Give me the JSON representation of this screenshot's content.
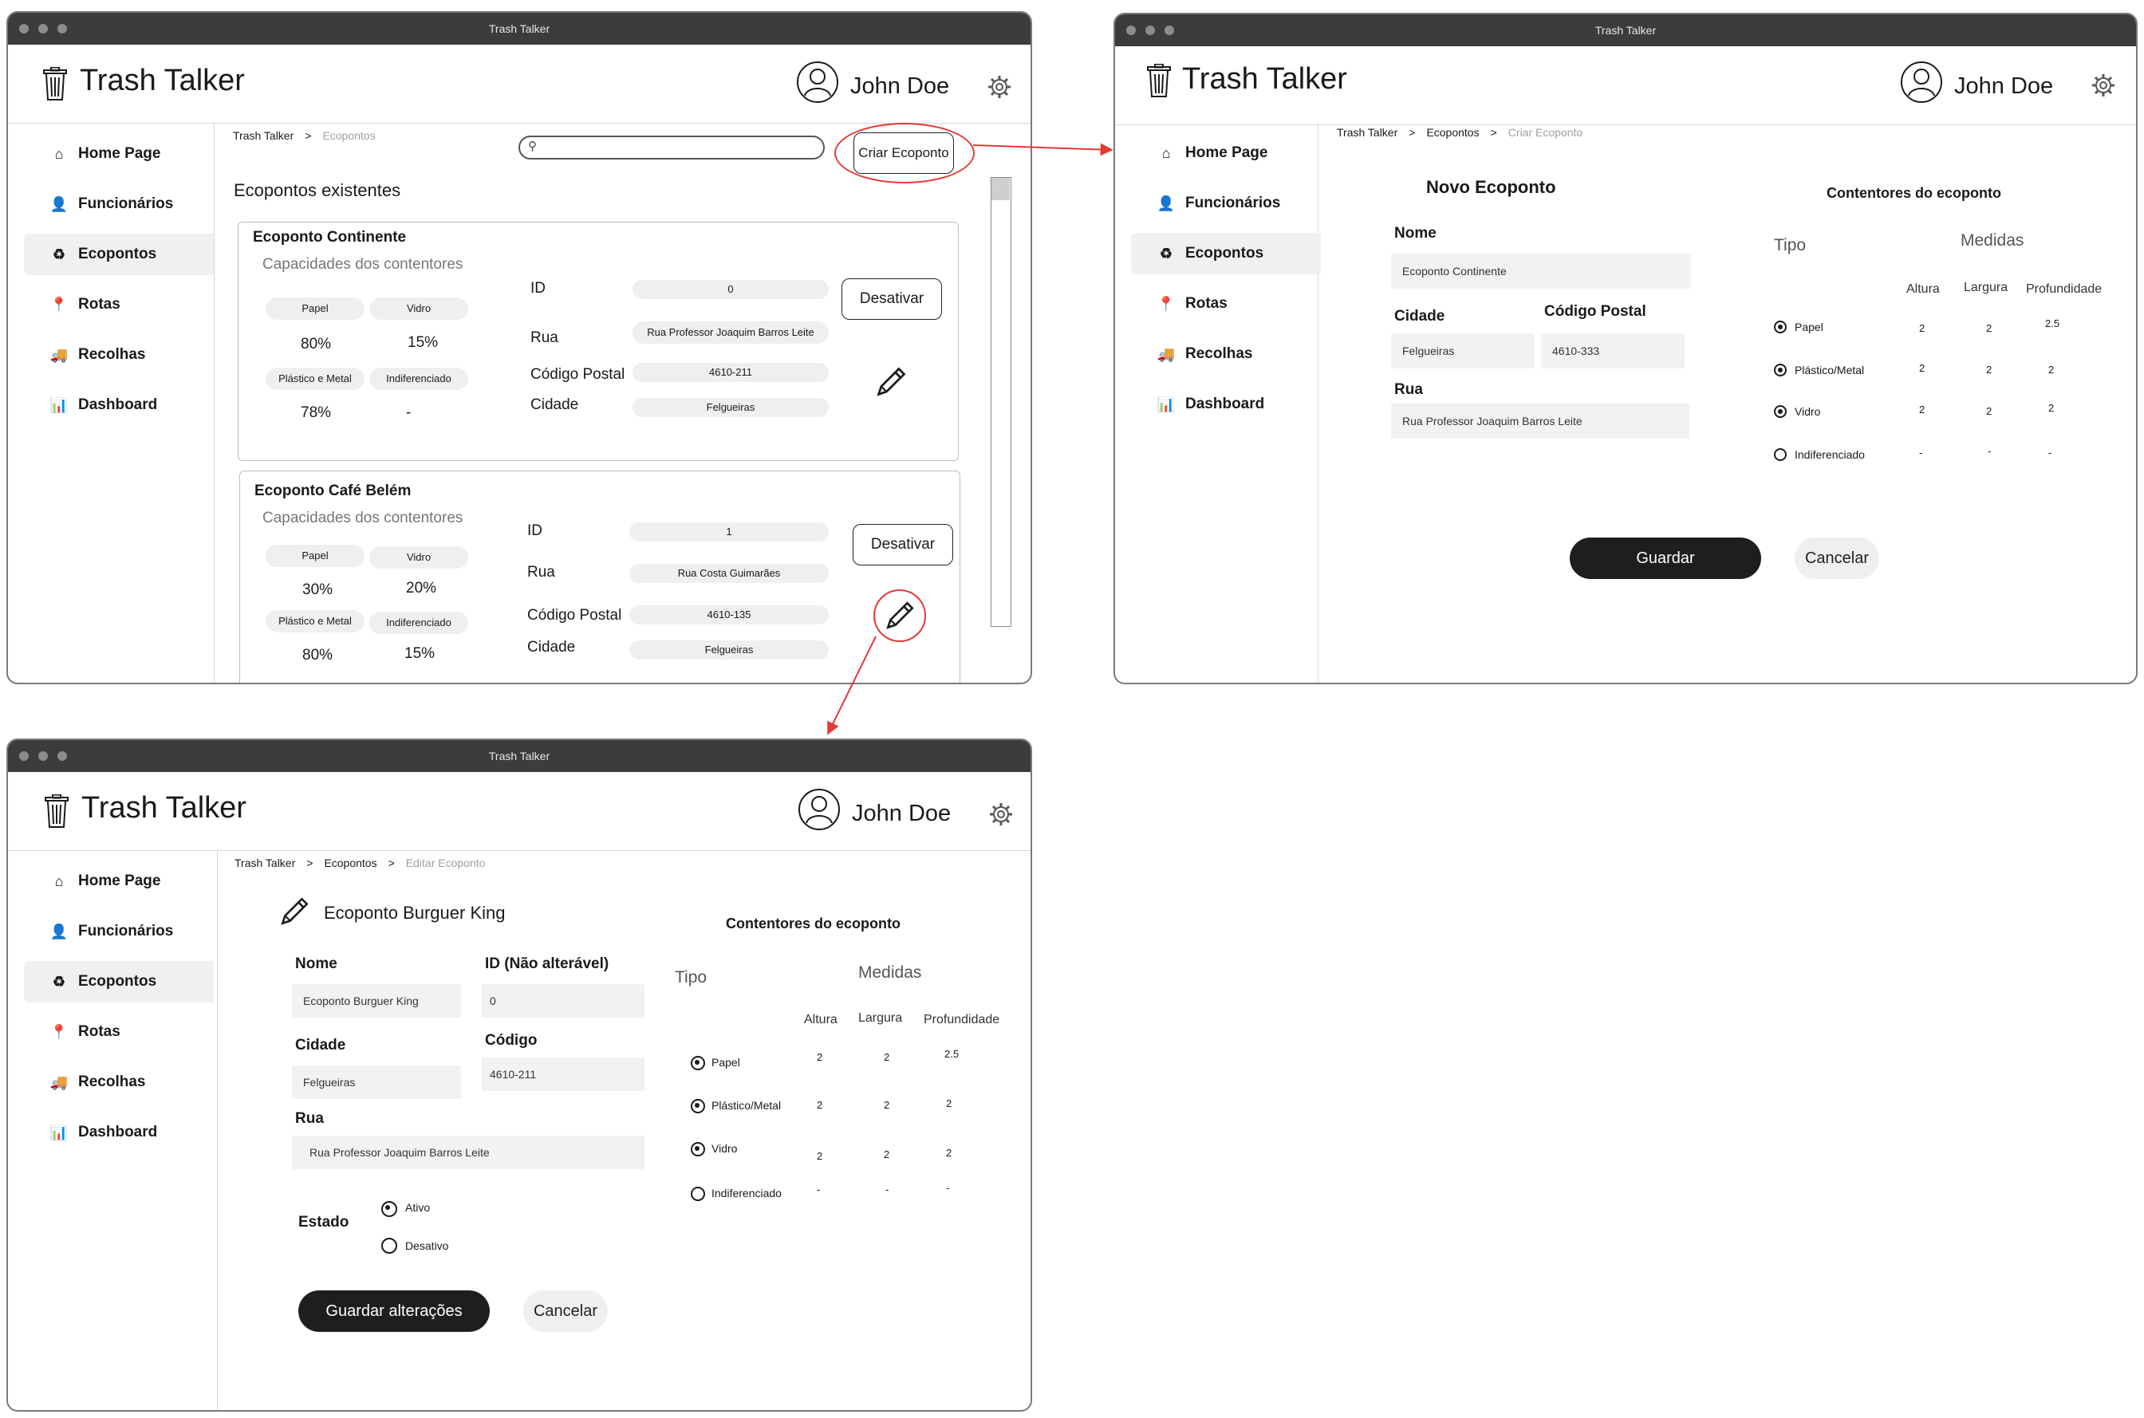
{
  "app": {
    "window_title": "Trash Talker",
    "name": "Trash Talker",
    "user": "John Doe"
  },
  "nav": [
    "Home Page",
    "Funcionários",
    "Ecopontos",
    "Rotas",
    "Recolhas",
    "Dashboard"
  ],
  "nav_icons": [
    "home-icon",
    "user-icon",
    "recycle-icon",
    "map-pin-icon",
    "truck-icon",
    "bar-chart-icon"
  ],
  "colors": {
    "annotation": "#e53935",
    "primary_button": "#1e1e1e",
    "titlebar": "#3c3c3c"
  },
  "list_screen": {
    "breadcrumb": [
      "Trash Talker",
      ">",
      "Ecopontos"
    ],
    "search": {
      "value": ""
    },
    "create_button": "Criar Ecoponto",
    "heading": "Ecopontos existentes",
    "capacities_label": "Capacidades dos contentores",
    "field_labels": {
      "id": "ID",
      "street": "Rua",
      "postal": "Código Postal",
      "city": "Cidade"
    },
    "deactivate_label": "Desativar",
    "cards": [
      {
        "name": "Ecoponto Continente",
        "types": [
          "Papel",
          "Vidro",
          "Plástico e Metal",
          "Indiferenciado"
        ],
        "capacities": [
          "80%",
          "15%",
          "78%",
          "-"
        ],
        "id": "0",
        "street": "Rua Professor Joaquim Barros Leite",
        "postal": "4610-211",
        "city": "Felgueiras"
      },
      {
        "name": "Ecoponto Café Belém",
        "types": [
          "Papel",
          "Vidro",
          "Plástico e Metal",
          "Indiferenciado"
        ],
        "capacities": [
          "30%",
          "20%",
          "80%",
          "15%"
        ],
        "id": "1",
        "street": "Rua Costa Guimarães",
        "postal": "4610-135",
        "city": "Felgueiras"
      }
    ]
  },
  "create_screen": {
    "breadcrumb": [
      "Trash Talker",
      ">",
      "Ecopontos",
      ">",
      "Criar Ecoponto"
    ],
    "heading": "Novo Ecoponto",
    "labels": {
      "name": "Nome",
      "city": "Cidade",
      "postal": "Código Postal",
      "street": "Rua"
    },
    "values": {
      "name": "Ecoponto Continente",
      "city": "Felgueiras",
      "postal": "4610-333",
      "street": "Rua Professor Joaquim Barros Leite"
    },
    "containers_title": "Contentores do ecoponto",
    "type_label": "Tipo",
    "measures_label": "Medidas",
    "columns": [
      "Altura",
      "Largura",
      "Profundidade"
    ],
    "rows": [
      {
        "type": "Papel",
        "selected": true,
        "values": [
          "2",
          "2",
          "2.5"
        ]
      },
      {
        "type": "Plástico/Metal",
        "selected": true,
        "values": [
          "2",
          "2",
          "2"
        ]
      },
      {
        "type": "Vidro",
        "selected": true,
        "values": [
          "2",
          "2",
          "2"
        ]
      },
      {
        "type": "Indiferenciado",
        "selected": false,
        "values": [
          "-",
          "-",
          "-"
        ]
      }
    ],
    "save": "Guardar",
    "cancel": "Cancelar"
  },
  "edit_screen": {
    "breadcrumb": [
      "Trash Talker",
      ">",
      "Ecopontos",
      ">",
      "Editar Ecoponto"
    ],
    "heading": "Ecoponto Burguer King",
    "labels": {
      "name": "Nome",
      "id": "ID (Não alterável)",
      "city": "Cidade",
      "code": "Código",
      "street": "Rua",
      "state": "Estado"
    },
    "values": {
      "name": "Ecoponto Burguer King",
      "id": "0",
      "city": "Felgueiras",
      "code": "4610-211",
      "street": "Rua Professor Joaquim Barros Leite"
    },
    "state_options": [
      {
        "label": "Ativo",
        "selected": true
      },
      {
        "label": "Desativo",
        "selected": false
      }
    ],
    "containers_title": "Contentores do ecoponto",
    "type_label": "Tipo",
    "measures_label": "Medidas",
    "columns": [
      "Altura",
      "Largura",
      "Profundidade"
    ],
    "rows": [
      {
        "type": "Papel",
        "selected": true,
        "values": [
          "2",
          "2",
          "2.5"
        ]
      },
      {
        "type": "Plástico/Metal",
        "selected": true,
        "values": [
          "2",
          "2",
          "2"
        ]
      },
      {
        "type": "Vidro",
        "selected": true,
        "values": [
          "2",
          "2",
          "2"
        ]
      },
      {
        "type": "Indiferenciado",
        "selected": false,
        "values": [
          "-",
          "-",
          "-"
        ]
      }
    ],
    "save": "Guardar alterações",
    "cancel": "Cancelar"
  }
}
